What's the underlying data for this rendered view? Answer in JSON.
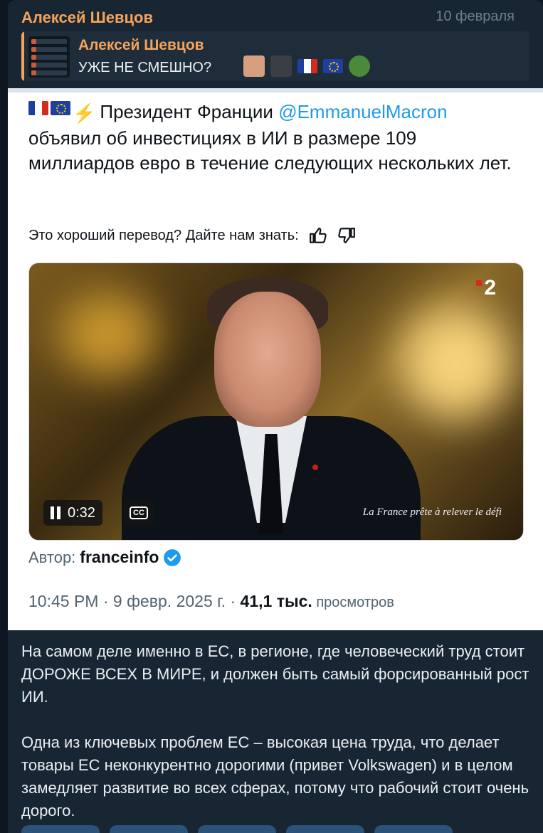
{
  "message": {
    "sender": "Алексей Шевцов",
    "date": "10 февраля",
    "reply": {
      "name": "Алексей Шевцов",
      "text": "УЖЕ НЕ СМЕШНО?"
    },
    "body_paragraphs": [
      "На самом деле именно в ЕС, в регионе, где человеческий труд стоит ДОРОЖЕ ВСЕХ В МИРЕ, и должен быть самый форсированный рост ИИ.",
      "Одна из ключевых проблем ЕС – высокая цена труда, что делает товары ЕС неконкурентно дорогими (привет Volkswagen) и в целом замедляет развитие во всех сферах, потому что рабочий стоит очень дорого."
    ]
  },
  "tweet": {
    "text_prefix": "Президент Франции ",
    "mention": "@EmmanuelMacron",
    "text_suffix": " объявил об инвестициях в ИИ в размере 109 миллиардов евро в течение следующих нескольких лет.",
    "translate_prompt": "Это хороший перевод? Дайте нам знать:",
    "video": {
      "time": "0:32",
      "cc_label": "CC",
      "channel_logo": "2",
      "caption": "La France prête à relever le défi"
    },
    "author_label": "Автор:",
    "author_name": "franceinfo",
    "timestamp": "10:45 PM · 9 февр. 2025 г. · ",
    "views_count": "41,1 тыс.",
    "views_label": " просмотров"
  },
  "colors": {
    "sender": "#f5a35b",
    "mention": "#1d9bf0",
    "bubble": "#182533",
    "background": "#0e1621"
  },
  "icons": [
    "flag-france-icon",
    "flag-eu-icon",
    "lightning-icon",
    "thumbs-up-icon",
    "thumbs-down-icon",
    "pause-icon",
    "captions-icon",
    "verified-badge-icon"
  ]
}
